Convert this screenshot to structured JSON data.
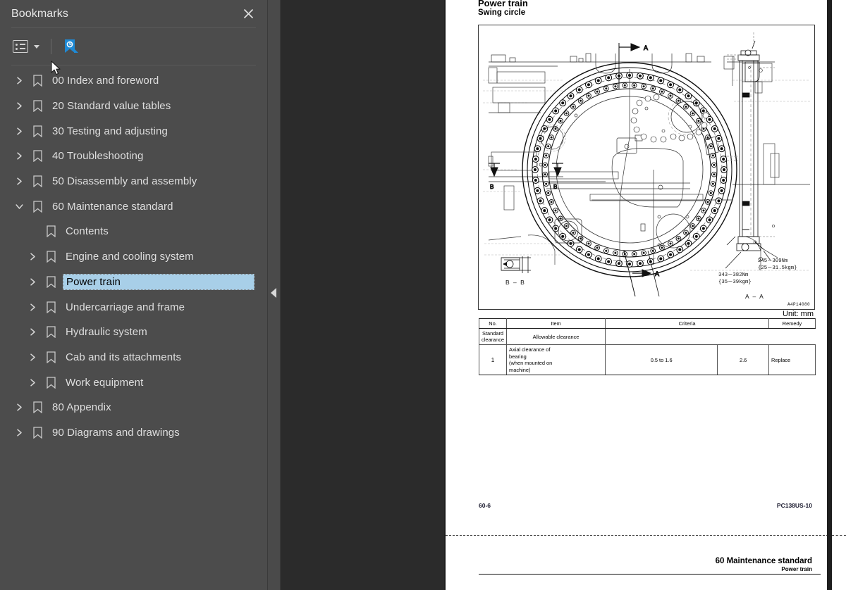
{
  "panel": {
    "title": "Bookmarks",
    "close_icon": "close-icon",
    "toolbar": {
      "options_icon": "list-options-icon",
      "options_caret_icon": "chevron-down-icon",
      "new_bookmark_icon": "new-bookmark-icon",
      "cursor_icon": "mouse-cursor"
    }
  },
  "tree": {
    "items": [
      {
        "label": "00 Index and foreword",
        "depth": 0,
        "arrow": "collapsed",
        "selected": false
      },
      {
        "label": "20 Standard value tables",
        "depth": 0,
        "arrow": "collapsed",
        "selected": false
      },
      {
        "label": "30 Testing and adjusting",
        "depth": 0,
        "arrow": "collapsed",
        "selected": false
      },
      {
        "label": "40 Troubleshooting",
        "depth": 0,
        "arrow": "collapsed",
        "selected": false
      },
      {
        "label": "50 Disassembly and assembly",
        "depth": 0,
        "arrow": "collapsed",
        "selected": false
      },
      {
        "label": "60 Maintenance standard",
        "depth": 0,
        "arrow": "expanded",
        "selected": false
      },
      {
        "label": "Contents",
        "depth": 1,
        "arrow": "none",
        "selected": false
      },
      {
        "label": "Engine and cooling system",
        "depth": 1,
        "arrow": "collapsed",
        "selected": false
      },
      {
        "label": "Power train",
        "depth": 1,
        "arrow": "collapsed",
        "selected": true
      },
      {
        "label": "Undercarriage and frame",
        "depth": 1,
        "arrow": "collapsed",
        "selected": false
      },
      {
        "label": "Hydraulic system",
        "depth": 1,
        "arrow": "collapsed",
        "selected": false
      },
      {
        "label": "Cab and its attachments",
        "depth": 1,
        "arrow": "collapsed",
        "selected": false
      },
      {
        "label": "Work equipment",
        "depth": 1,
        "arrow": "collapsed",
        "selected": false
      },
      {
        "label": "80 Appendix",
        "depth": 0,
        "arrow": "collapsed",
        "selected": false
      },
      {
        "label": "90 Diagrams and drawings",
        "depth": 0,
        "arrow": "collapsed",
        "selected": false
      }
    ]
  },
  "splitter": {
    "collapse_icon": "collapse-panel-arrow"
  },
  "document": {
    "heading_main": "Power train",
    "heading_sub": "Swing circle",
    "figure": {
      "drawing_id": "A4P14080",
      "section_a_label": "A",
      "section_a_label2": "A",
      "section_b_label": "B",
      "section_b_label2": "B",
      "detail_bb_caption": "B – B",
      "detail_aa_caption": "A – A",
      "torque_1_line1": "245－309Nm",
      "torque_1_line2": "{25－31.5kgm}",
      "torque_2_line1": "343－382Nm",
      "torque_2_line2": "{35－39kgm}"
    },
    "unit_note": "Unit: mm",
    "table": {
      "headers": [
        "No.",
        "Item",
        "Criteria",
        "Remedy"
      ],
      "sub_headers": [
        "Standard clearance",
        "Allowable  clearance"
      ],
      "rows": [
        {
          "no": "1",
          "item": "Axial clearance of\nbearing\n(when mounted on\nmachine)",
          "standard": "0.5 to 1.6",
          "allowable": "2.6",
          "remedy": "Replace"
        }
      ]
    },
    "footer_left": "60-6",
    "footer_right": "PC138US-10",
    "next_page_header_main": "60 Maintenance standard",
    "next_page_header_sub": "Power train"
  }
}
